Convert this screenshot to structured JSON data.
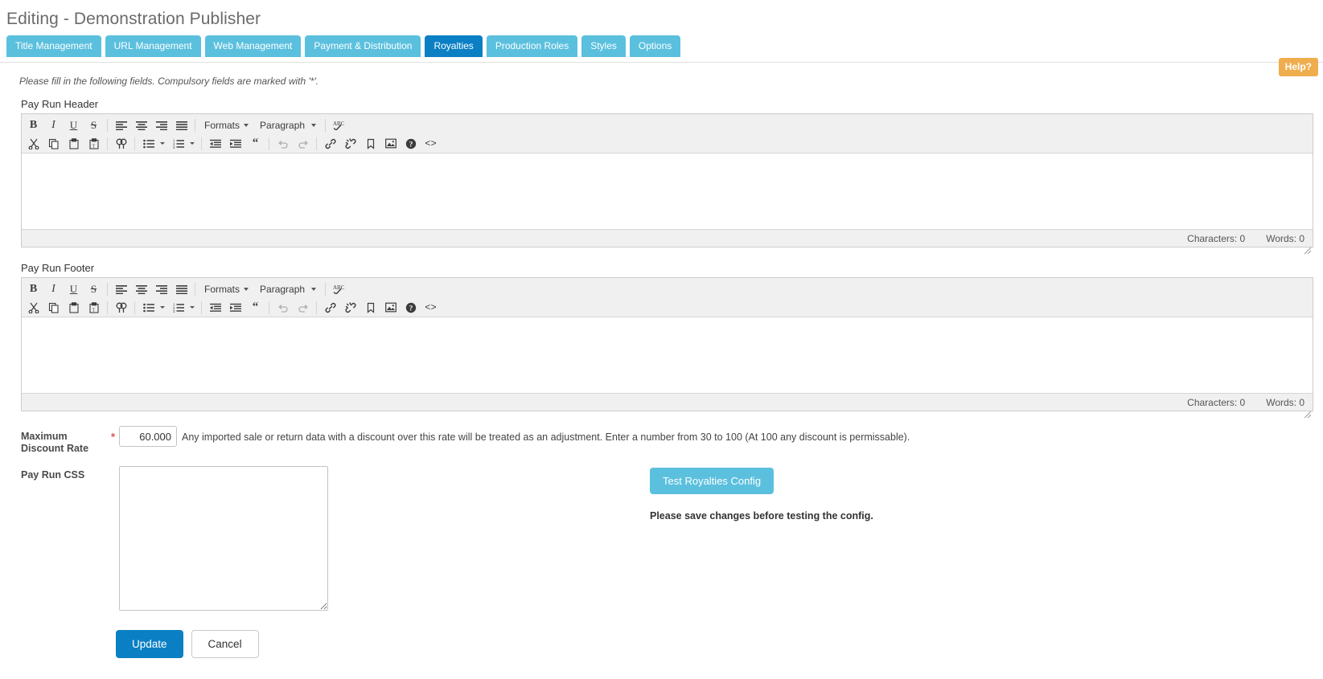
{
  "header": {
    "title": "Editing - Demonstration Publisher",
    "help_label": "Help?"
  },
  "tabs": [
    {
      "label": "Title Management",
      "active": false
    },
    {
      "label": "URL Management",
      "active": false
    },
    {
      "label": "Web Management",
      "active": false
    },
    {
      "label": "Payment & Distribution",
      "active": false
    },
    {
      "label": "Royalties",
      "active": true
    },
    {
      "label": "Production Roles",
      "active": false
    },
    {
      "label": "Styles",
      "active": false
    },
    {
      "label": "Options",
      "active": false
    }
  ],
  "instructions": "Please fill in the following fields. Compulsory fields are marked with '*'.",
  "editors": [
    {
      "label": "Pay Run Header",
      "content": "",
      "formats_label": "Formats",
      "paragraph_label": "Paragraph",
      "characters_label": "Characters: 0",
      "words_label": "Words: 0"
    },
    {
      "label": "Pay Run Footer",
      "content": "",
      "formats_label": "Formats",
      "paragraph_label": "Paragraph",
      "characters_label": "Characters: 0",
      "words_label": "Words: 0"
    }
  ],
  "toolbar_icons_row1": [
    "bold-icon",
    "italic-icon",
    "underline-icon",
    "strikethrough-icon",
    "align-left-icon",
    "align-center-icon",
    "align-right-icon",
    "align-justify-icon"
  ],
  "toolbar_icons_row2": [
    "cut-icon",
    "copy-icon",
    "paste-icon",
    "paste-text-icon",
    "search-replace-icon",
    "bullet-list-icon",
    "numbered-list-icon",
    "outdent-icon",
    "indent-icon",
    "blockquote-icon",
    "undo-icon",
    "redo-icon",
    "link-icon",
    "unlink-icon",
    "anchor-icon",
    "image-icon",
    "help-icon",
    "source-code-icon"
  ],
  "discount": {
    "label": "Maximum Discount Rate",
    "required_mark": "*",
    "value": "60.000",
    "help_text": "Any imported sale or return data with a discount over this rate will be treated as an adjustment. Enter a number from 30 to 100 (At 100 any discount is permissable)."
  },
  "pay_run_css": {
    "label": "Pay Run CSS",
    "value": "",
    "placeholder": ""
  },
  "test_config": {
    "button_label": "Test Royalties Config",
    "note": "Please save changes before testing the config."
  },
  "actions": {
    "update_label": "Update",
    "cancel_label": "Cancel"
  },
  "colors": {
    "tab": "#5bc0de",
    "tab_active": "#0a7fc4",
    "help_badge": "#f0ad4e",
    "primary_button": "#0a7fc4",
    "required": "#d9534f"
  }
}
